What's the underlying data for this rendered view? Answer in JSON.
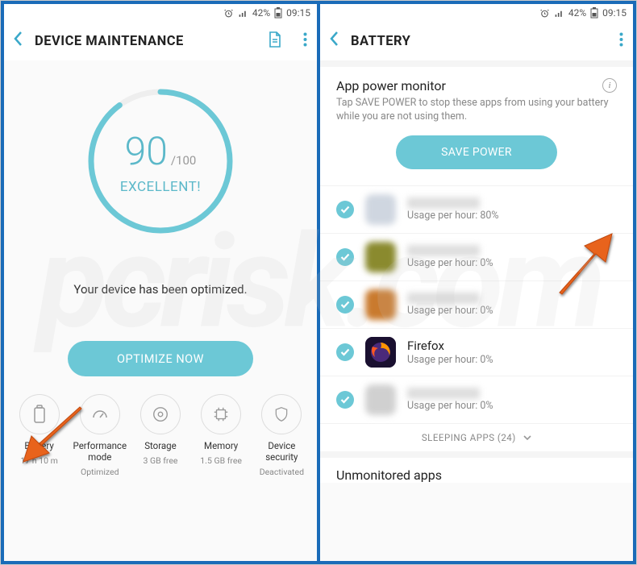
{
  "statusbar": {
    "battery_pct": "42%",
    "time": "09:15"
  },
  "left": {
    "title": "DEVICE MAINTENANCE",
    "score": "90",
    "score_denom": "/100",
    "score_label": "EXCELLENT!",
    "optimized_msg": "Your device has been optimized.",
    "optimize_btn": "OPTIMIZE NOW",
    "shortcuts": [
      {
        "label": "Battery",
        "sub": "17 h 10 m"
      },
      {
        "label": "Performance mode",
        "sub": "Optimized"
      },
      {
        "label": "Storage",
        "sub": "3 GB free"
      },
      {
        "label": "Memory",
        "sub": "1.5 GB free"
      },
      {
        "label": "Device security",
        "sub": "Deactivated"
      }
    ]
  },
  "right": {
    "title": "BATTERY",
    "section_title": "App power monitor",
    "section_desc": "Tap SAVE POWER to stop these apps from using your battery while you are not using them.",
    "save_btn": "SAVE POWER",
    "apps": [
      {
        "name": "",
        "usage": "Usage per hour: 80%",
        "blur": true,
        "icon_bg": "#cfd6e0"
      },
      {
        "name": "",
        "usage": "Usage per hour: 0%",
        "blur": true,
        "icon_bg": "#8a8a2e"
      },
      {
        "name": "",
        "usage": "Usage per hour: 0%",
        "blur": true,
        "icon_bg": "#c97a2e"
      },
      {
        "name": "Firefox",
        "usage": "Usage per hour: 0%",
        "blur": false,
        "icon_bg": "#1a1030"
      },
      {
        "name": "",
        "usage": "Usage per hour: 0%",
        "blur": true,
        "icon_bg": "#d0d0d0"
      }
    ],
    "sleeping": "SLEEPING APPS (24)",
    "unmonitored": "Unmonitored apps"
  }
}
